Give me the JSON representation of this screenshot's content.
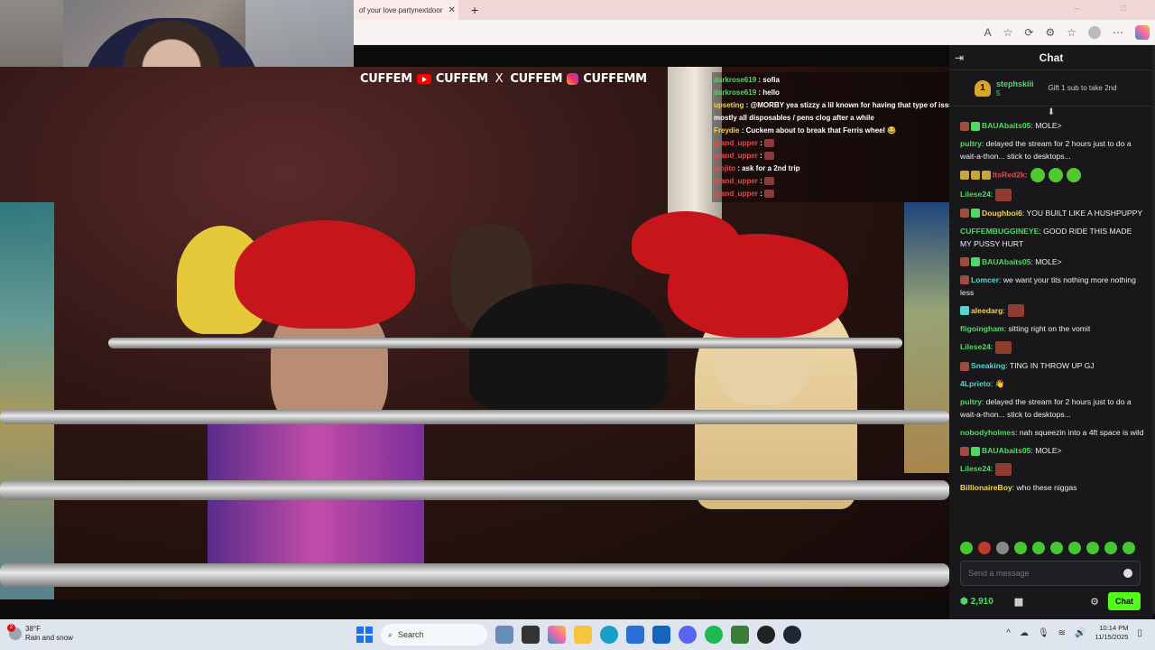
{
  "browser": {
    "tab_title": "of your love partynextdoor",
    "tab_close": "✕",
    "new_tab": "+",
    "win_controls": [
      "–",
      "□"
    ]
  },
  "video_overlay": {
    "brand": {
      "part1": "CUFFEM",
      "part2": "CUFFEM",
      "sep": "X",
      "part3": "CUFFEM",
      "part4": "CUFFEMM"
    },
    "chat": [
      {
        "user": "darkrose619",
        "text": " : sofia",
        "color": "#4fd964"
      },
      {
        "user": "darkrose619",
        "text": " : hello",
        "color": "#4fd964"
      },
      {
        "user": "upseting",
        "text": " : @MORBY yea stizzy a lil known for having that type of issues mostly all disposables / pens clog after a while",
        "color": "#f3d54a"
      },
      {
        "user": "Freydie",
        "text": " : Cuckem about to break that Ferris wheel 😂",
        "color": "#f3d54a"
      },
      {
        "user": "grand_upper",
        "text": " : ",
        "color": "#e84a4a",
        "emote": true
      },
      {
        "user": "grand_upper",
        "text": " : ",
        "color": "#e84a4a",
        "emote": true
      },
      {
        "user": "piojito",
        "text": " : ask for a 2nd trip",
        "color": "#e84a4a"
      },
      {
        "user": "grand_upper",
        "text": " : ",
        "color": "#e84a4a",
        "emote": true
      },
      {
        "user": "grand_upper",
        "text": " : ",
        "color": "#e84a4a",
        "emote": true
      }
    ]
  },
  "chat_panel": {
    "title": "Chat",
    "gifter": {
      "rank": "1",
      "name": "stephskiii",
      "count": "5",
      "gift_text": "Gift 1 sub to take 2nd"
    },
    "messages": [
      {
        "user": "BAUAbaits05",
        "text": ": MOLE>",
        "color": "#4fd964",
        "badges": [
          "p",
          "g"
        ]
      },
      {
        "user": "pultry",
        "text": ": delayed the stream for 2 hours just to do a wait-a-thon... stick to desktops...",
        "color": "#4fd964",
        "badges": []
      },
      {
        "user": "ItsRed2k",
        "text": ":",
        "color": "#e84a4a",
        "badges": [
          "y",
          "y",
          "y"
        ],
        "emotes": 3
      },
      {
        "user": "Lilese24",
        "text": ":",
        "color": "#4fd964",
        "badges": [],
        "red_emote": true
      },
      {
        "user": "Doughboi6",
        "text": ": YOU BUILT LIKE A HUSHPUPPY",
        "color": "#f3d54a",
        "badges": [
          "p",
          "g"
        ]
      },
      {
        "user": "CUFFEMBUGGINEYE",
        "text": ": GOOD RIDE THIS MADE MY PUSSY HURT",
        "color": "#4fd964",
        "badges": []
      },
      {
        "user": "BAUAbaits05",
        "text": ": MOLE>",
        "color": "#4fd964",
        "badges": [
          "p",
          "g"
        ]
      },
      {
        "user": "Lomcer",
        "text": ": we want your tits nothing more nothing less",
        "color": "#4fd9d2",
        "badges": [
          "p"
        ]
      },
      {
        "user": "aleedarg",
        "text": ":",
        "color": "#f3d54a",
        "badges": [
          "c"
        ],
        "red_emote": true
      },
      {
        "user": "fligoingham",
        "text": ": sitting right on the vomit",
        "color": "#4fd964",
        "badges": []
      },
      {
        "user": "Lilese24",
        "text": ":",
        "color": "#4fd964",
        "badges": [],
        "red_emote": true
      },
      {
        "user": "Sneaking",
        "text": ": TING IN THROW UP GJ",
        "color": "#4fd9d2",
        "badges": [
          "p"
        ]
      },
      {
        "user": "4Lprieto",
        "text": ": 👋",
        "color": "#4fd9d2",
        "badges": []
      },
      {
        "user": "pultry",
        "text": ": delayed the stream for 2 hours just to do a wait-a-thon... stick to desktops...",
        "color": "#4fd964",
        "badges": []
      },
      {
        "user": "nobodyholmes",
        "text": ": nah squeezin into a 4ft space is wild",
        "color": "#4fd964",
        "badges": []
      },
      {
        "user": "BAUAbaits05",
        "text": ": MOLE>",
        "color": "#4fd964",
        "badges": [
          "p",
          "g"
        ]
      },
      {
        "user": "Lilese24",
        "text": ":",
        "color": "#4fd964",
        "badges": [],
        "red_emote": true
      },
      {
        "user": "BillionaireBoy",
        "text": ": who these niggas",
        "color": "#f3d54a",
        "badges": []
      }
    ],
    "input_placeholder": "Send a message",
    "points": "2,910",
    "chat_button": "Chat"
  },
  "taskbar": {
    "weather_temp": "38°F",
    "weather_desc": "Rain and snow",
    "weather_badge": "2",
    "search_label": "Search",
    "time": "10:14 PM",
    "date": "11/15/2025"
  },
  "colors": {
    "accent": "#53fc18",
    "panel_bg": "#18181b",
    "username_green": "#4fd964"
  }
}
